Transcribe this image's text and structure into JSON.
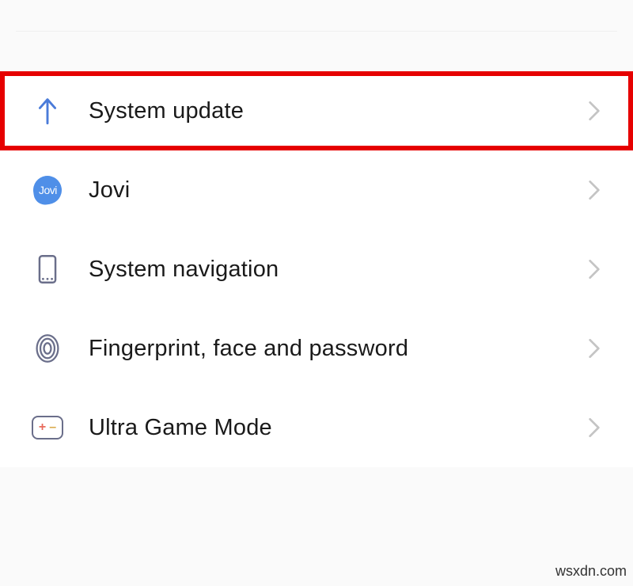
{
  "settings": {
    "items": [
      {
        "label": "System update",
        "icon": "arrow-up",
        "highlighted": true
      },
      {
        "label": "Jovi",
        "icon": "jovi",
        "highlighted": false
      },
      {
        "label": "System navigation",
        "icon": "phone-nav",
        "highlighted": false
      },
      {
        "label": "Fingerprint, face and password",
        "icon": "fingerprint",
        "highlighted": false
      },
      {
        "label": "Ultra Game Mode",
        "icon": "gamepad",
        "highlighted": false
      }
    ]
  },
  "watermark": "wsxdn.com",
  "colors": {
    "highlight_border": "#e60000",
    "icon_blue": "#4a7bd9",
    "icon_grey": "#6a6e8a",
    "jovi_bg": "#4f8fe8",
    "chevron": "#bdbdbd"
  },
  "jovi_text": "Jovi"
}
